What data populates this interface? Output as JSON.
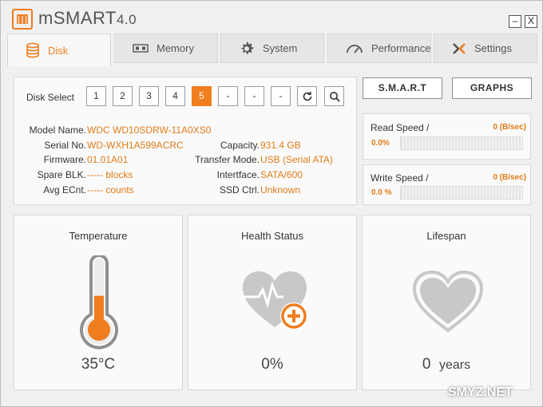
{
  "app": {
    "name": "mSMART",
    "version": "4.0"
  },
  "window_controls": {
    "minimize": "–",
    "close": "X"
  },
  "tabs": [
    {
      "label": "Disk",
      "icon": "disk-stack-icon",
      "active": true
    },
    {
      "label": "Memory",
      "icon": "memory-chip-icon",
      "active": false
    },
    {
      "label": "System",
      "icon": "gear-icon",
      "active": false
    },
    {
      "label": "Performance",
      "icon": "speedometer-icon",
      "active": false
    },
    {
      "label": "Settings",
      "icon": "settings-x-icon",
      "active": false
    }
  ],
  "disk_select": {
    "label": "Disk Select",
    "buttons": [
      "1",
      "2",
      "3",
      "4",
      "5",
      "-",
      "-",
      "-"
    ],
    "selected": "5",
    "refresh_icon": "refresh-icon",
    "search_icon": "search-icon"
  },
  "disk_info": {
    "model_label": "Model Name.",
    "model_value": "WDC WD10SDRW-11A0XS0",
    "serial_label": "Serial No.",
    "serial_value": "WD-WXH1A599ACRC",
    "firmware_label": "Firmware.",
    "firmware_value": "01.01A01",
    "spare_label": "Spare BLK.",
    "spare_value": "----- blocks",
    "avgecnt_label": "Avg ECnt.",
    "avgecnt_value": "----- counts",
    "capacity_label": "Capacity.",
    "capacity_value": "931.4 GB",
    "transfer_label": "Transfer Mode.",
    "transfer_value": "USB (Serial ATA)",
    "interface_label": "Intertface.",
    "interface_value": "SATA/600",
    "ssd_label": "SSD Ctrl.",
    "ssd_value": "Unknown"
  },
  "actions": {
    "smart_label": "S.M.A.R.T",
    "graphs_label": "GRAPHS"
  },
  "read_speed": {
    "title": "Read Speed /",
    "unit_value": "0 (B/sec)",
    "percent": "0.0%",
    "fill": 0.0
  },
  "write_speed": {
    "title": "Write Speed /",
    "unit_value": "0 (B/sec)",
    "percent": "0.0 %",
    "fill": 0.0
  },
  "temperature": {
    "title": "Temperature",
    "value": "35°C",
    "level": 0.45
  },
  "health": {
    "title": "Health Status",
    "value": "0%"
  },
  "lifespan": {
    "title": "Lifespan",
    "value_num": "0",
    "value_unit": "years"
  },
  "watermark": {
    "text": "SMYZ.NET"
  },
  "colors": {
    "accent": "#f07d1e",
    "panel_bg": "#fafafa",
    "icon_gray": "#c8c8c8"
  }
}
